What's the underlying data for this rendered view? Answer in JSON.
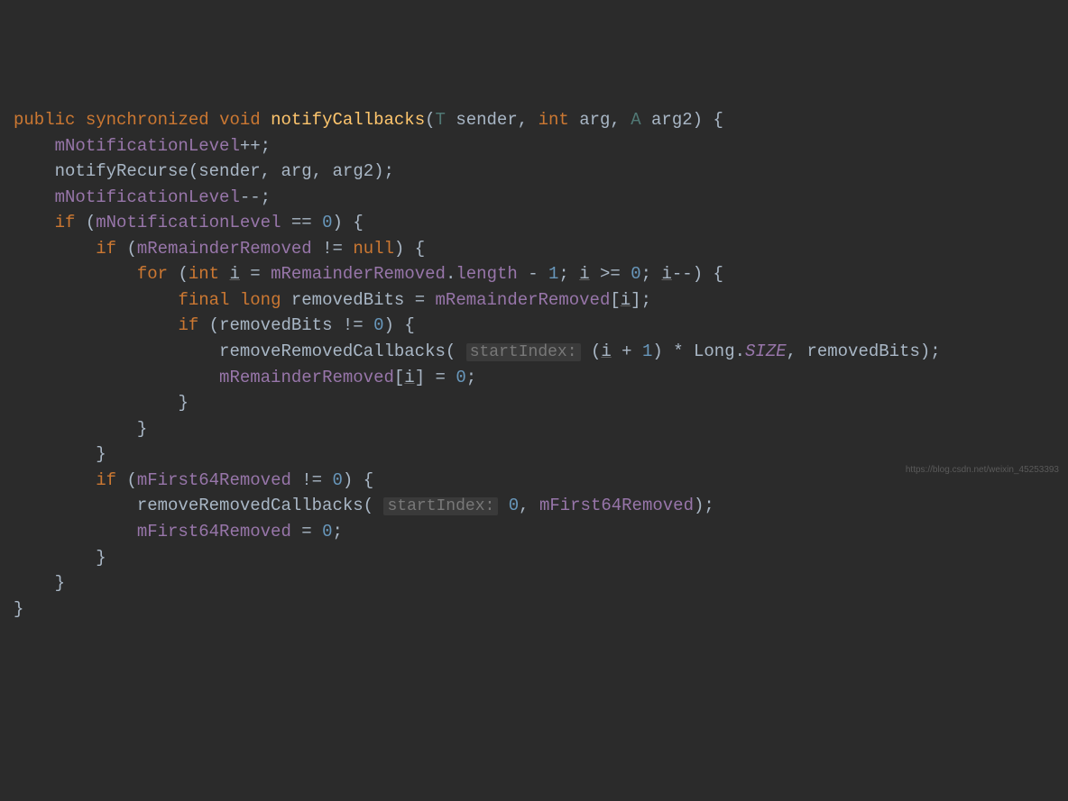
{
  "code": {
    "kw_public": "public",
    "kw_synchronized": "synchronized",
    "kw_void": "void",
    "method_name": "notifyCallbacks",
    "generic_T": "T",
    "param_sender": "sender",
    "kw_int": "int",
    "param_arg": "arg",
    "generic_A": "A",
    "param_arg2": "arg2",
    "brace_open": "{",
    "brace_close": "}",
    "field_mNotificationLevel": "mNotificationLevel",
    "op_inc": "++",
    "op_dec": "--",
    "method_notifyRecurse": "notifyRecurse",
    "kw_if": "if",
    "op_eq": "==",
    "num_0": "0",
    "field_mRemainderRemoved": "mRemainderRemoved",
    "op_neq": "!=",
    "kw_null": "null",
    "kw_for": "for",
    "var_i": "i",
    "prop_length": "length",
    "op_minus": "-",
    "num_1": "1",
    "op_gte": ">=",
    "kw_final": "final",
    "kw_long": "long",
    "var_removedBits": "removedBits",
    "method_removeRemovedCallbacks": "removeRemovedCallbacks",
    "hint_startIndex": "startIndex:",
    "op_plus": "+",
    "op_mult": "*",
    "cls_Long": "Long",
    "static_SIZE": "SIZE",
    "field_mFirst64Removed": "mFirst64Removed",
    "op_assign": "="
  },
  "watermark": "https://blog.csdn.net/weixin_45253393"
}
